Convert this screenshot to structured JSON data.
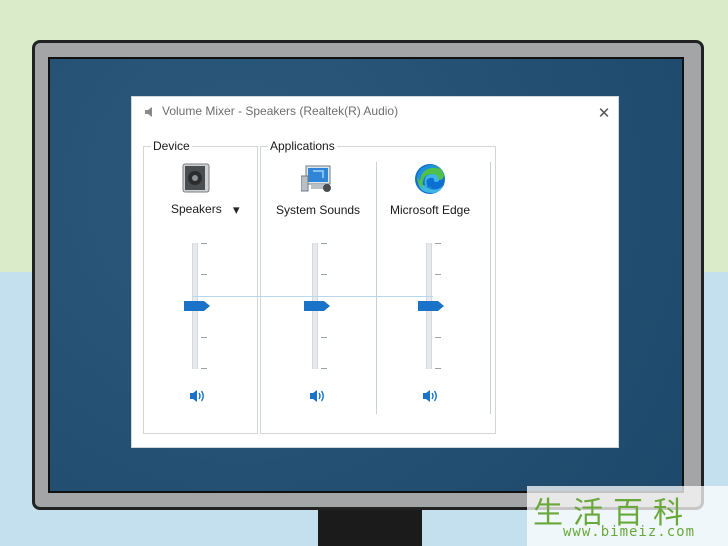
{
  "window": {
    "title": "Volume Mixer - Speakers (Realtek(R) Audio)",
    "close_glyph": "✕"
  },
  "device": {
    "group_label": "Device",
    "name": "Speakers",
    "dropdown_glyph": "▾",
    "icon": "speaker-device-icon",
    "volume_fraction": 0.5
  },
  "applications": {
    "group_label": "Applications",
    "items": [
      {
        "name": "System Sounds",
        "icon": "system-sounds-icon",
        "volume_fraction": 0.5
      },
      {
        "name": "Microsoft Edge",
        "icon": "microsoft-edge-icon",
        "volume_fraction": 0.5
      }
    ]
  },
  "mute_icon": "speaker-volume-icon",
  "colors": {
    "accent": "#1a73c8",
    "edge_blue": "#0c6fd1",
    "edge_green": "#4fc04a"
  },
  "watermark": {
    "chars": "生活百科",
    "url": "www.bimeiz.com"
  }
}
